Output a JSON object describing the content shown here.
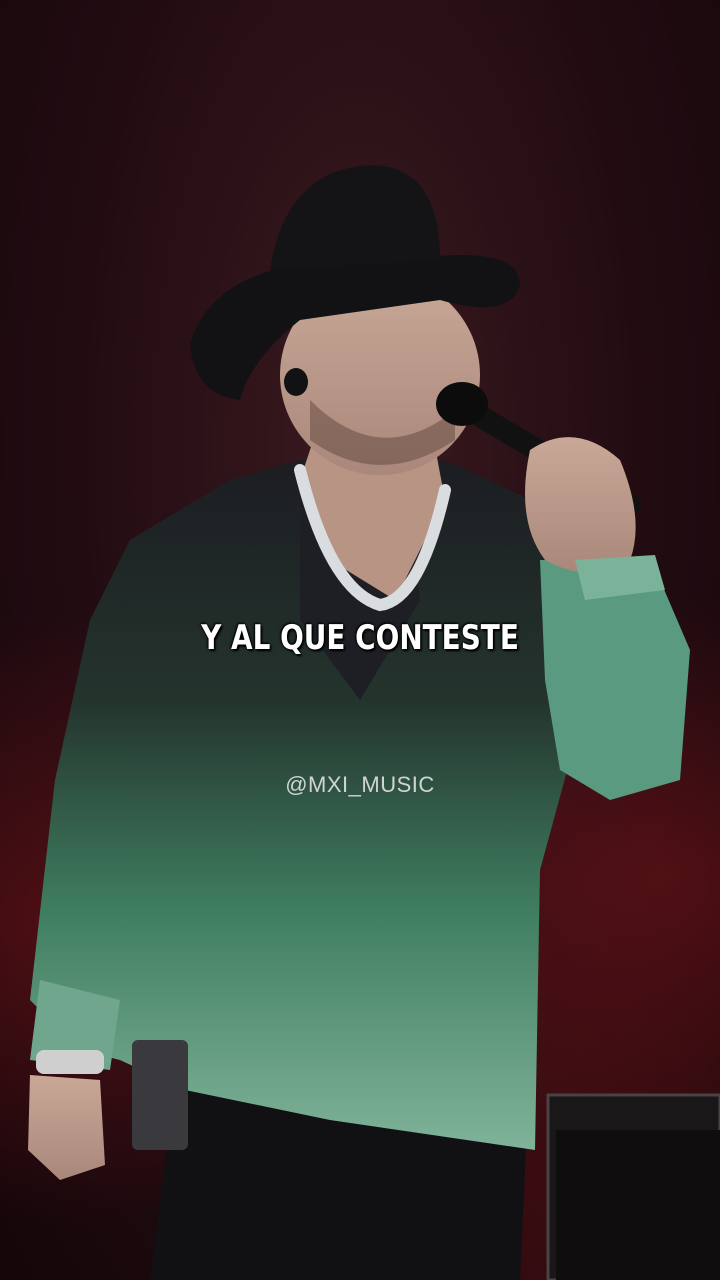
{
  "video": {
    "lyric_text": "Y AL QUE CONTESTE",
    "watermark": "@MXI_MUSIC"
  },
  "colors": {
    "background": "#220c12",
    "shirt_green": "#3a7a5c",
    "shirt_dark": "#1c1d22",
    "hat": "#121214",
    "lyric": "#ffffff"
  }
}
